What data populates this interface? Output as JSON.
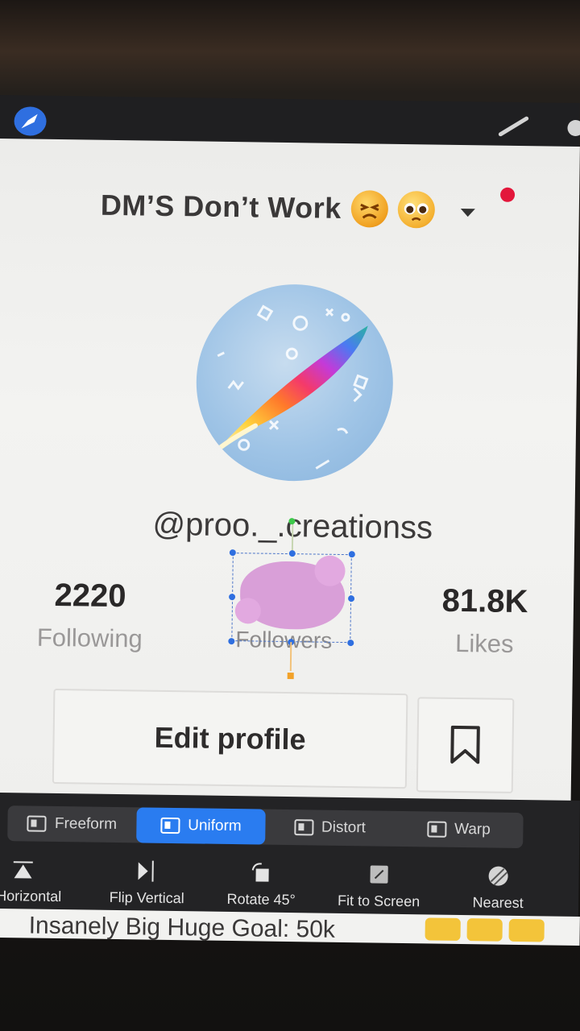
{
  "canvas": {
    "title": "DM’S Don’t Work",
    "title_emojis": [
      "tired-face-emoji",
      "pleading-face-emoji"
    ],
    "username": "@proo._.creationss",
    "stats": {
      "following": {
        "value": "2220",
        "label": "Following"
      },
      "followers": {
        "value": "",
        "label": "Followers"
      },
      "likes": {
        "value": "81.8K",
        "label": "Likes"
      }
    },
    "edit_profile_label": "Edit profile",
    "bottom_text": "Insanely Big Huge Goal: 50k"
  },
  "transform_modes": [
    {
      "label": "Freeform",
      "active": false
    },
    {
      "label": "Uniform",
      "active": true
    },
    {
      "label": "Distort",
      "active": false
    },
    {
      "label": "Warp",
      "active": false
    }
  ],
  "transform_actions": [
    {
      "label": "p Horizontal"
    },
    {
      "label": "Flip Vertical"
    },
    {
      "label": "Rotate 45°"
    },
    {
      "label": "Fit to Screen"
    },
    {
      "label": "Nearest"
    }
  ],
  "colors": {
    "accent": "#2a7cf0",
    "blob": "#d79ad6",
    "notification": "#e3173b",
    "toolbar": "#232325"
  },
  "icons": [
    "procreate-icon",
    "brush-icon",
    "smudge-icon",
    "dropdown-icon",
    "bookmark-icon",
    "flip-horizontal-icon",
    "flip-vertical-icon",
    "rotate-icon",
    "fit-screen-icon",
    "nearest-icon"
  ]
}
